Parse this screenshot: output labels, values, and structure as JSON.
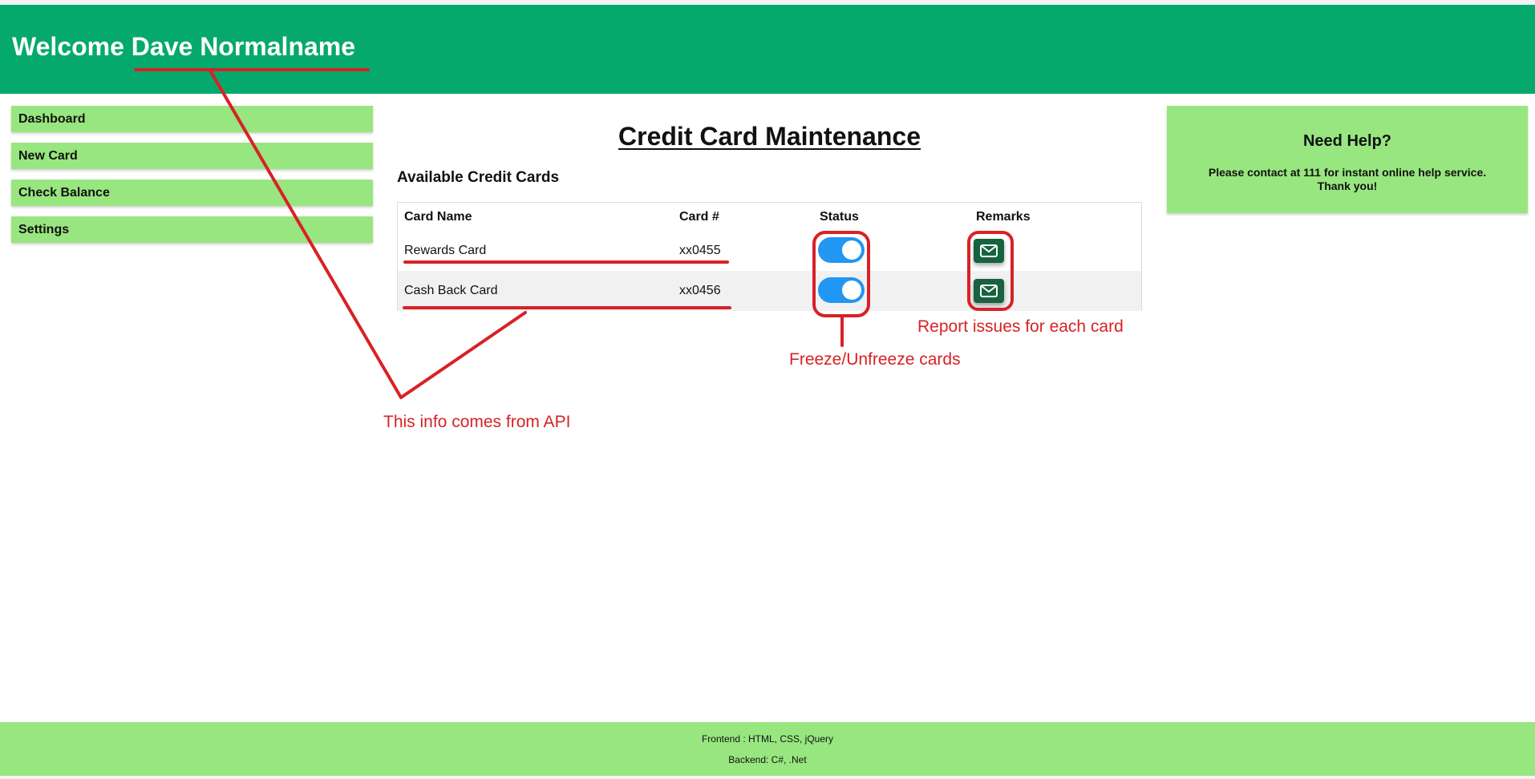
{
  "header": {
    "title": "Welcome Dave Normalname"
  },
  "sidebar": {
    "items": [
      {
        "label": "Dashboard"
      },
      {
        "label": "New Card"
      },
      {
        "label": "Check Balance"
      },
      {
        "label": "Settings"
      }
    ]
  },
  "main": {
    "title": "Credit Card Maintenance",
    "section_title": "Available Credit Cards",
    "table": {
      "headers": [
        "Card Name",
        "Card #",
        "Status",
        "Remarks"
      ],
      "rows": [
        {
          "name": "Rewards Card",
          "number": "xx0455",
          "status_on": true,
          "remark_icon": "envelope-icon"
        },
        {
          "name": "Cash Back Card",
          "number": "xx0456",
          "status_on": true,
          "remark_icon": "envelope-icon"
        }
      ]
    }
  },
  "help": {
    "title": "Need Help?",
    "line1": "Please contact at 111 for instant online help service.",
    "line2": "Thank you!"
  },
  "footer": {
    "line1": "Frontend : HTML, CSS, jQuery",
    "line2": "Backend: C#, .Net"
  },
  "annotations": {
    "report_issues": "Report issues for each card",
    "freeze": "Freeze/Unfreeze cards",
    "api_info": "This info comes from API"
  },
  "colors": {
    "header_bg": "#06a96c",
    "sidebar_bg": "#98e67f",
    "toggle_on": "#2196f3",
    "mail_button": "#17623f",
    "annotation": "#d72226"
  }
}
